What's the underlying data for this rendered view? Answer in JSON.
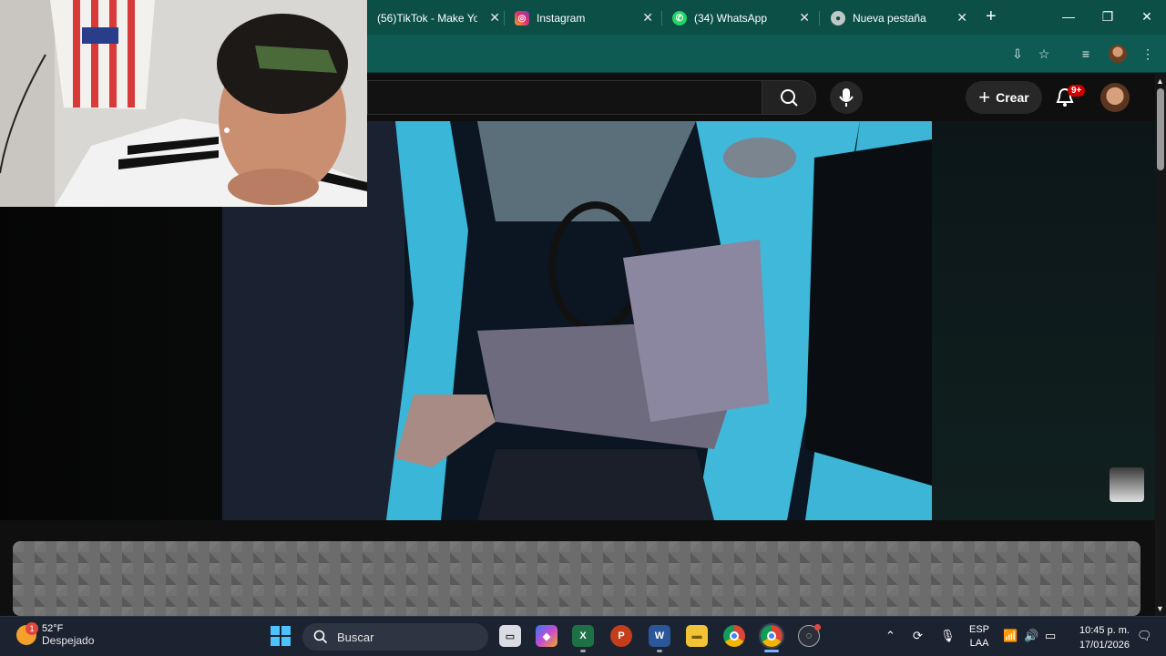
{
  "browser": {
    "tabs": [
      {
        "title": "(56)TikTok - Make Yo",
        "favicon": "tiktok-icon"
      },
      {
        "title": "Instagram",
        "favicon": "instagram-icon"
      },
      {
        "title": "(34) WhatsApp",
        "favicon": "whatsapp-icon"
      },
      {
        "title": "Nueva pestaña",
        "favicon": "chrome-globe-icon"
      }
    ],
    "new_tab_glyph": "+",
    "window_controls": [
      "minimize",
      "restore",
      "close"
    ],
    "accent_color": "#0b4f47"
  },
  "youtube": {
    "create_label": "Crear",
    "notification_badge": "9+"
  },
  "taskbar": {
    "weather_temp": "52°F",
    "weather_desc": "Despejado",
    "weather_badge": "1",
    "search_label": "Buscar",
    "language_top": "ESP",
    "language_bottom": "LAA",
    "time": "10:45 p. m.",
    "date": "17/01/2026"
  }
}
